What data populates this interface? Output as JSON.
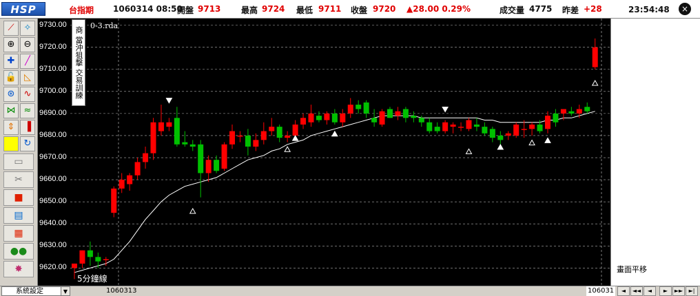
{
  "header": {
    "logo": "HSP",
    "symbol": "台指期",
    "date_time": "1060314  08:50",
    "open_label": "開盤",
    "open_value": "9713",
    "high_label": "最高",
    "high_value": "9724",
    "low_label": "最低",
    "low_value": "9711",
    "close_label": "收盤",
    "close_value": "9720",
    "change": "▲28.00  0.29%",
    "volume_label": "成交量",
    "volume_value": "4775",
    "diff_label": "昨差",
    "diff_value": "+28",
    "clock": "23:54:48",
    "close_icon": "×"
  },
  "chart": {
    "name": "0-3.rda",
    "side_label": "當沖狙擊 交易訓練",
    "side_top": "商",
    "period_label": "5分鐘線",
    "y_ticks": [
      "9730.00",
      "9720.00",
      "9710.00",
      "9700.00",
      "9690.00",
      "9680.00",
      "9670.00",
      "9660.00",
      "9650.00",
      "9640.00",
      "9630.00",
      "9620.00"
    ],
    "right_panel_label": "畫面平移"
  },
  "footer": {
    "settings_label": "系統設定",
    "dropdown_icon": "▼",
    "date_left": "1060313",
    "date_right": "106031",
    "nav_icons": [
      "◄",
      "◄◄",
      "◄",
      "►",
      "►►",
      "►|"
    ]
  },
  "colors": {
    "up": "#ff0000",
    "down": "#00c000",
    "grid": "#ffffff",
    "ma": "#ffffff"
  },
  "chart_data": {
    "type": "candlestick",
    "ylim": [
      9612,
      9733
    ],
    "candles": [
      {
        "o": 9620,
        "h": 9622,
        "l": 9615,
        "c": 9622
      },
      {
        "o": 9622,
        "h": 9628,
        "l": 9620,
        "c": 9628
      },
      {
        "o": 9628,
        "h": 9632,
        "l": 9621,
        "c": 9625
      },
      {
        "o": 9625,
        "h": 9627,
        "l": 9620,
        "c": 9623
      },
      {
        "o": 9624,
        "h": 9625,
        "l": 9621,
        "c": 9624
      },
      {
        "o": 9645,
        "h": 9657,
        "l": 9643,
        "c": 9656
      },
      {
        "o": 9656,
        "h": 9663,
        "l": 9654,
        "c": 9660
      },
      {
        "o": 9658,
        "h": 9663,
        "l": 9655,
        "c": 9662
      },
      {
        "o": 9662,
        "h": 9670,
        "l": 9660,
        "c": 9668
      },
      {
        "o": 9668,
        "h": 9675,
        "l": 9665,
        "c": 9672
      },
      {
        "o": 9672,
        "h": 9688,
        "l": 9669,
        "c": 9686
      },
      {
        "o": 9682,
        "h": 9694,
        "l": 9680,
        "c": 9686
      },
      {
        "o": 9684,
        "h": 9688,
        "l": 9682,
        "c": 9686
      },
      {
        "o": 9688,
        "h": 9693,
        "l": 9675,
        "c": 9676
      },
      {
        "o": 9677,
        "h": 9682,
        "l": 9675,
        "c": 9676
      },
      {
        "o": 9676,
        "h": 9678,
        "l": 9673,
        "c": 9675
      },
      {
        "o": 9676,
        "h": 9678,
        "l": 9652,
        "c": 9663
      },
      {
        "o": 9663,
        "h": 9671,
        "l": 9659,
        "c": 9669
      },
      {
        "o": 9669,
        "h": 9671,
        "l": 9663,
        "c": 9664
      },
      {
        "o": 9665,
        "h": 9677,
        "l": 9664,
        "c": 9676
      },
      {
        "o": 9676,
        "h": 9685,
        "l": 9674,
        "c": 9682
      },
      {
        "o": 9680,
        "h": 9682,
        "l": 9677,
        "c": 9680
      },
      {
        "o": 9680,
        "h": 9683,
        "l": 9671,
        "c": 9675
      },
      {
        "o": 9675,
        "h": 9681,
        "l": 9673,
        "c": 9678
      },
      {
        "o": 9678,
        "h": 9686,
        "l": 9676,
        "c": 9682
      },
      {
        "o": 9682,
        "h": 9688,
        "l": 9680,
        "c": 9684
      },
      {
        "o": 9684,
        "h": 9685,
        "l": 9677,
        "c": 9679
      },
      {
        "o": 9679,
        "h": 9682,
        "l": 9677,
        "c": 9680
      },
      {
        "o": 9680,
        "h": 9687,
        "l": 9678,
        "c": 9685
      },
      {
        "o": 9685,
        "h": 9690,
        "l": 9683,
        "c": 9688
      },
      {
        "o": 9686,
        "h": 9694,
        "l": 9684,
        "c": 9690
      },
      {
        "o": 9689,
        "h": 9691,
        "l": 9686,
        "c": 9687
      },
      {
        "o": 9687,
        "h": 9691,
        "l": 9685,
        "c": 9690
      },
      {
        "o": 9690,
        "h": 9692,
        "l": 9685,
        "c": 9686
      },
      {
        "o": 9686,
        "h": 9692,
        "l": 9684,
        "c": 9690
      },
      {
        "o": 9690,
        "h": 9697,
        "l": 9688,
        "c": 9694
      },
      {
        "o": 9694,
        "h": 9696,
        "l": 9690,
        "c": 9692
      },
      {
        "o": 9695,
        "h": 9696,
        "l": 9688,
        "c": 9690
      },
      {
        "o": 9688,
        "h": 9692,
        "l": 9684,
        "c": 9686
      },
      {
        "o": 9685,
        "h": 9692,
        "l": 9684,
        "c": 9691
      },
      {
        "o": 9692,
        "h": 9693,
        "l": 9688,
        "c": 9688
      },
      {
        "o": 9689,
        "h": 9693,
        "l": 9687,
        "c": 9691
      },
      {
        "o": 9692,
        "h": 9693,
        "l": 9686,
        "c": 9688
      },
      {
        "o": 9689,
        "h": 9691,
        "l": 9686,
        "c": 9688
      },
      {
        "o": 9688,
        "h": 9689,
        "l": 9684,
        "c": 9686
      },
      {
        "o": 9686,
        "h": 9688,
        "l": 9681,
        "c": 9682
      },
      {
        "o": 9684,
        "h": 9686,
        "l": 9681,
        "c": 9682
      },
      {
        "o": 9682,
        "h": 9687,
        "l": 9681,
        "c": 9686
      },
      {
        "o": 9684,
        "h": 9686,
        "l": 9681,
        "c": 9685
      },
      {
        "o": 9684,
        "h": 9686,
        "l": 9682,
        "c": 9684
      },
      {
        "o": 9683,
        "h": 9688,
        "l": 9682,
        "c": 9687
      },
      {
        "o": 9685,
        "h": 9688,
        "l": 9682,
        "c": 9684
      },
      {
        "o": 9684,
        "h": 9686,
        "l": 9680,
        "c": 9681
      },
      {
        "o": 9683,
        "h": 9684,
        "l": 9677,
        "c": 9679
      },
      {
        "o": 9680,
        "h": 9682,
        "l": 9676,
        "c": 9678
      },
      {
        "o": 9680,
        "h": 9682,
        "l": 9678,
        "c": 9681
      },
      {
        "o": 9680,
        "h": 9686,
        "l": 9679,
        "c": 9685
      },
      {
        "o": 9683,
        "h": 9687,
        "l": 9679,
        "c": 9683
      },
      {
        "o": 9683,
        "h": 9686,
        "l": 9680,
        "c": 9685
      },
      {
        "o": 9685,
        "h": 9687,
        "l": 9681,
        "c": 9682
      },
      {
        "o": 9683,
        "h": 9691,
        "l": 9681,
        "c": 9689
      },
      {
        "o": 9690,
        "h": 9692,
        "l": 9684,
        "c": 9686
      },
      {
        "o": 9690,
        "h": 9692,
        "l": 9687,
        "c": 9692
      },
      {
        "o": 9691,
        "h": 9693,
        "l": 9689,
        "c": 9690
      },
      {
        "o": 9690,
        "h": 9694,
        "l": 9688,
        "c": 9692
      },
      {
        "o": 9693,
        "h": 9695,
        "l": 9690,
        "c": 9691
      },
      {
        "o": 9711,
        "h": 9724,
        "l": 9710,
        "c": 9720
      }
    ],
    "ma": [
      9618,
      9619,
      9620,
      9621,
      9622,
      9624,
      9628,
      9632,
      9637,
      9642,
      9646,
      9650,
      9653,
      9655,
      9657,
      9658,
      9659,
      9660,
      9661,
      9663,
      9665,
      9667,
      9669,
      9670,
      9671,
      9673,
      9674,
      9676,
      9677,
      9678,
      9680,
      9681,
      9682,
      9683,
      9684,
      9685,
      9686,
      9687,
      9688,
      9689,
      9689,
      9689,
      9689,
      9689,
      9688,
      9688,
      9688,
      9688,
      9688,
      9688,
      9688,
      9688,
      9687,
      9687,
      9686,
      9686,
      9686,
      9686,
      9686,
      9686,
      9687,
      9687,
      9688,
      9688,
      9689,
      9690,
      9691
    ],
    "markers": [
      {
        "i": 12,
        "type": "down",
        "v": 9696
      },
      {
        "i": 15,
        "type": "up_open",
        "v": 9646
      },
      {
        "i": 28,
        "type": "up",
        "v": 9679
      },
      {
        "i": 27,
        "type": "up_open",
        "v": 9674
      },
      {
        "i": 33,
        "type": "up",
        "v": 9681
      },
      {
        "i": 47,
        "type": "down",
        "v": 9692
      },
      {
        "i": 50,
        "type": "up_open",
        "v": 9673
      },
      {
        "i": 54,
        "type": "up",
        "v": 9675
      },
      {
        "i": 58,
        "type": "up_open",
        "v": 9677
      },
      {
        "i": 60,
        "type": "up",
        "v": 9678
      },
      {
        "i": 66,
        "type": "up_open",
        "v": 9704
      }
    ]
  }
}
